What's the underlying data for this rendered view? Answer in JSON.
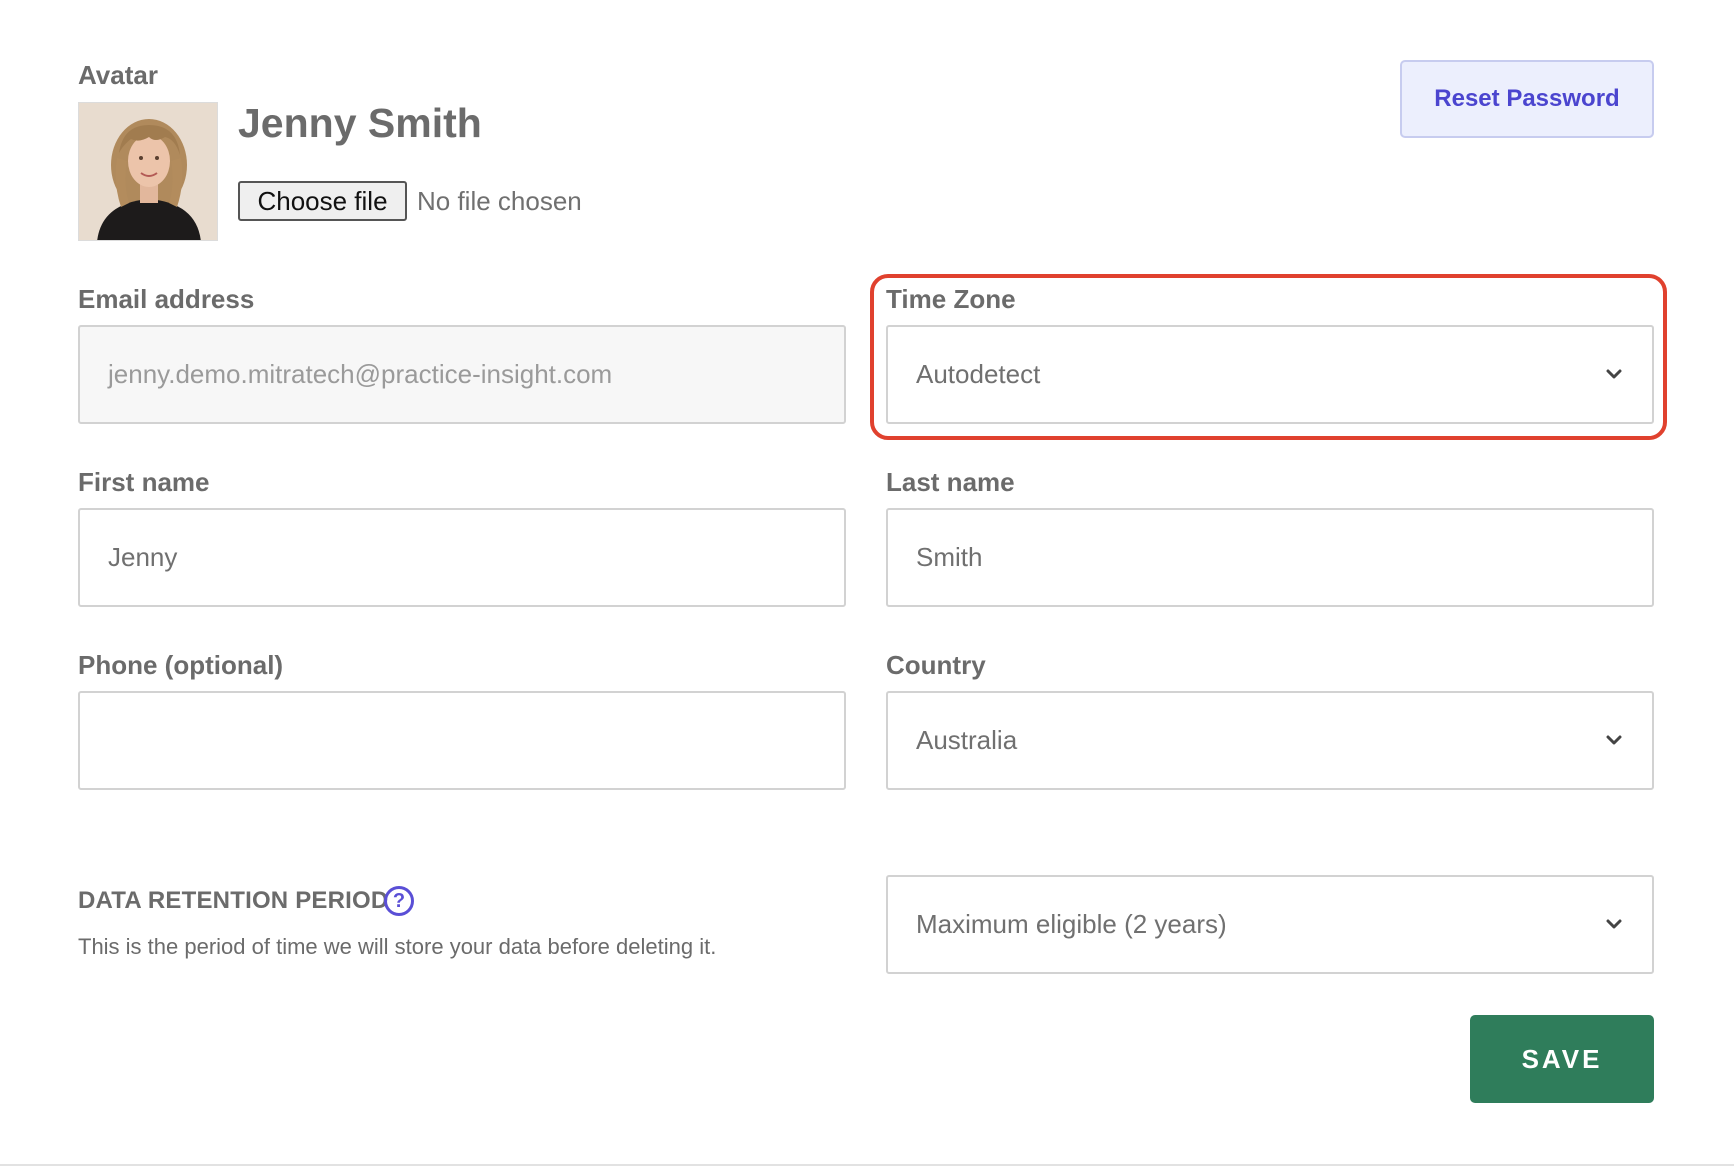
{
  "avatar": {
    "label": "Avatar",
    "user_name": "Jenny Smith",
    "choose_file_label": "Choose file",
    "no_file_text": "No file chosen"
  },
  "reset_password_label": "Reset Password",
  "email": {
    "label": "Email address",
    "value": "jenny.demo.mitratech@practice-insight.com"
  },
  "timezone": {
    "label": "Time Zone",
    "selected": "Autodetect"
  },
  "first_name": {
    "label": "First name",
    "value": "Jenny"
  },
  "last_name": {
    "label": "Last name",
    "value": "Smith"
  },
  "phone": {
    "label": "Phone (optional)",
    "value": ""
  },
  "country": {
    "label": "Country",
    "selected": "Australia"
  },
  "retention": {
    "title": "DATA RETENTION PERIOD",
    "help_glyph": "?",
    "description": "This is the period of time we will store your data before deleting it.",
    "selected": "Maximum eligible (2 years)"
  },
  "save_label": "SAVE",
  "colors": {
    "accent": "#4b45cf",
    "save": "#2f7d5b",
    "highlight": "#e0412e"
  },
  "icons": {
    "dropdown": "chevron-down-icon",
    "help": "question-circle-icon"
  }
}
